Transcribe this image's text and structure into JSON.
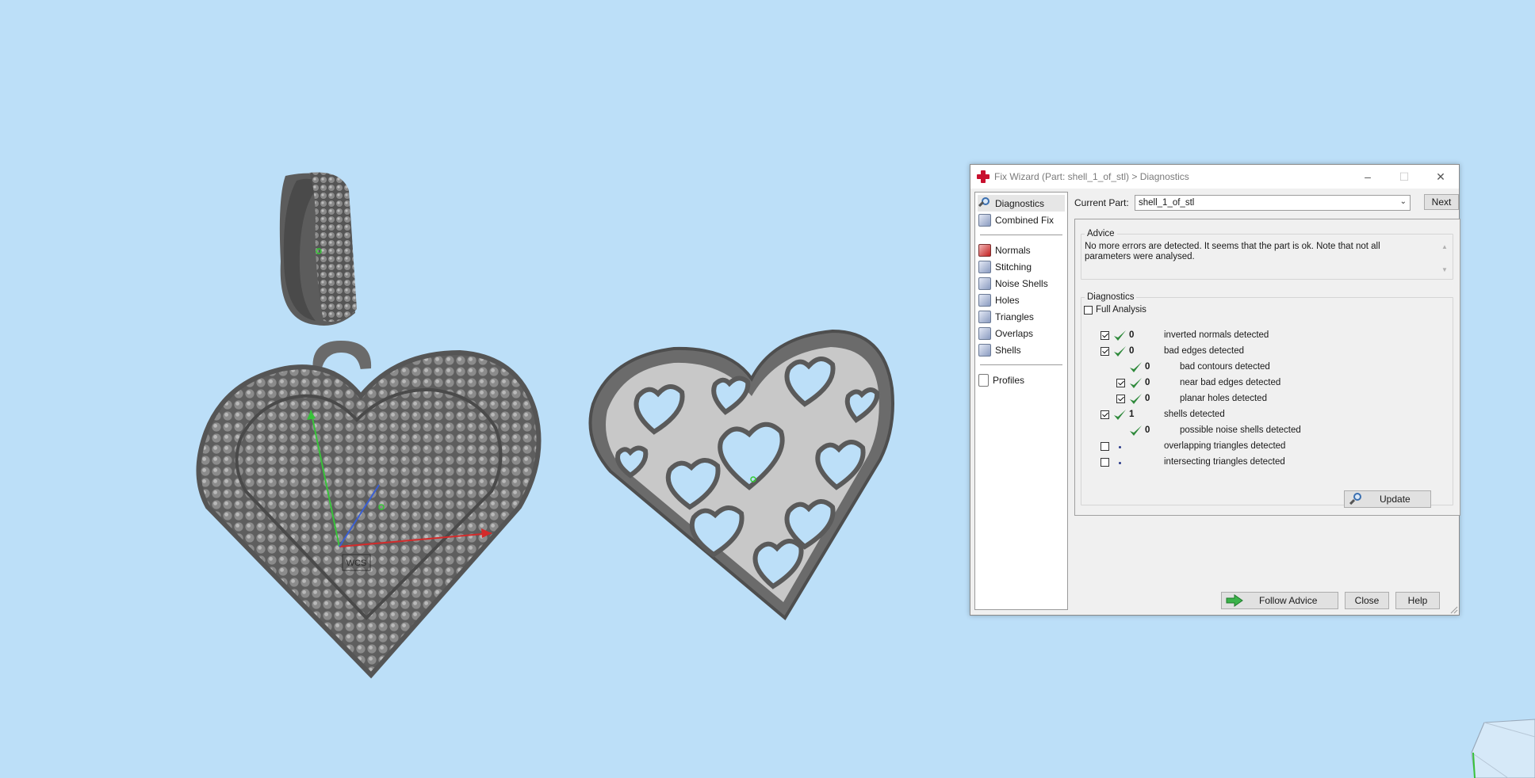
{
  "dialog": {
    "title": "Fix Wizard (Part: shell_1_of_stl) > Diagnostics",
    "window_controls": {
      "minimize": "–",
      "maximize": "☐",
      "close": "✕"
    }
  },
  "nav": {
    "top_items": [
      {
        "label": "Diagnostics",
        "icon": "magnifier-icon",
        "selected": true
      },
      {
        "label": "Combined Fix",
        "icon": "cube-icon"
      }
    ],
    "tool_items": [
      {
        "label": "Normals",
        "icon": "normals-icon"
      },
      {
        "label": "Stitching",
        "icon": "stitching-icon"
      },
      {
        "label": "Noise Shells",
        "icon": "noise-shells-icon"
      },
      {
        "label": "Holes",
        "icon": "holes-icon"
      },
      {
        "label": "Triangles",
        "icon": "triangles-icon"
      },
      {
        "label": "Overlaps",
        "icon": "overlaps-icon"
      },
      {
        "label": "Shells",
        "icon": "shells-icon"
      }
    ],
    "bottom_items": [
      {
        "label": "Profiles",
        "icon": "document-icon"
      }
    ]
  },
  "current_part": {
    "label": "Current Part:",
    "value": "shell_1_of_stl",
    "next_label": "Next"
  },
  "advice": {
    "legend": "Advice",
    "text": "No more errors are detected. It seems that the part is ok. Note that not all parameters were analysed."
  },
  "diagnostics": {
    "legend": "Diagnostics",
    "full_analysis_label": "Full Analysis",
    "full_analysis_checked": false,
    "rows": [
      {
        "checkbox": true,
        "checked": true,
        "status": "ok",
        "count": "0",
        "label": "inverted normals detected",
        "indent": 0
      },
      {
        "checkbox": true,
        "checked": true,
        "status": "ok",
        "count": "0",
        "label": "bad edges detected",
        "indent": 0
      },
      {
        "checkbox": false,
        "checked": false,
        "status": "ok",
        "count": "0",
        "label": "bad contours detected",
        "indent": 1
      },
      {
        "checkbox": true,
        "checked": true,
        "status": "ok",
        "count": "0",
        "label": "near bad edges detected",
        "indent": 1
      },
      {
        "checkbox": true,
        "checked": true,
        "status": "ok",
        "count": "0",
        "label": "planar holes detected",
        "indent": 1
      },
      {
        "checkbox": true,
        "checked": true,
        "status": "ok",
        "count": "1",
        "label": "shells detected",
        "indent": 0
      },
      {
        "checkbox": false,
        "checked": false,
        "status": "ok",
        "count": "0",
        "label": "possible noise shells detected",
        "indent": 1
      },
      {
        "checkbox": true,
        "checked": false,
        "status": "none",
        "count": "",
        "label": "overlapping triangles detected",
        "indent": 0
      },
      {
        "checkbox": true,
        "checked": false,
        "status": "none",
        "count": "",
        "label": "intersecting triangles detected",
        "indent": 0
      }
    ],
    "update_label": "Update"
  },
  "footer": {
    "follow_advice_label": "Follow Advice",
    "close_label": "Close",
    "help_label": "Help"
  },
  "viewport": {
    "axis_label": "WCS",
    "colors": {
      "background": "#bcdff8",
      "model": "#6e6e6e",
      "x_axis": "#d42a2a",
      "y_axis": "#38c23a",
      "z_axis": "#3a5fd4",
      "check_green": "#2f8a3c"
    }
  }
}
